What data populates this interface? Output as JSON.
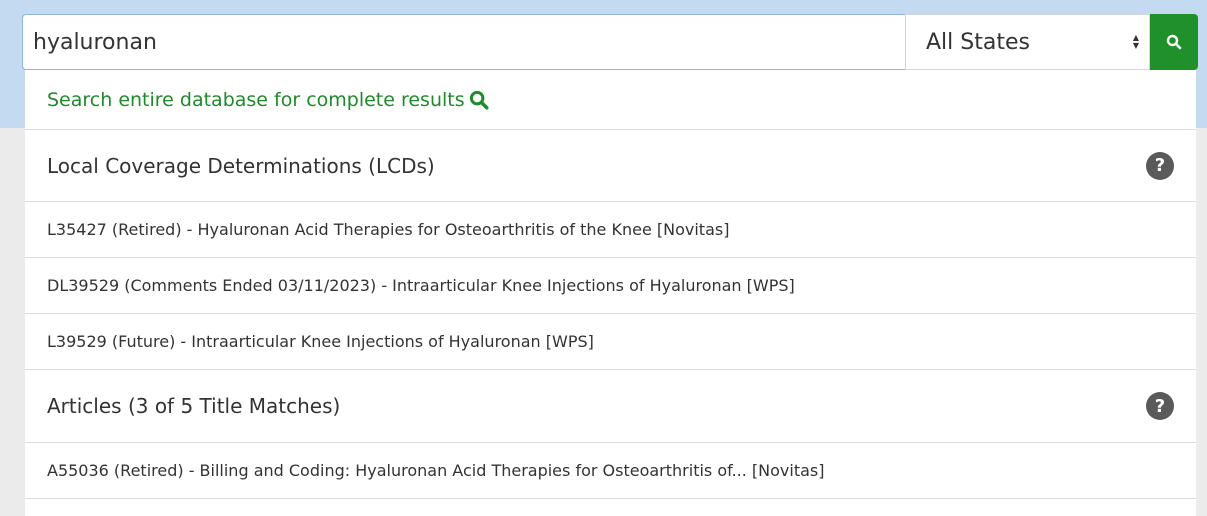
{
  "search": {
    "value": "hyaluronan",
    "state_selected": "All States",
    "button_icon": "search-icon",
    "accent_color": "#20902a"
  },
  "dropdown": {
    "search_all_label": "Search entire database for complete results",
    "sections": [
      {
        "title": "Local Coverage Determinations (LCDs)",
        "help_icon": "question-circle-icon",
        "items": [
          "L35427 (Retired) - Hyaluronan Acid Therapies for Osteoarthritis of the Knee [Novitas]",
          "DL39529 (Comments Ended 03/11/2023) - Intraarticular Knee Injections of Hyaluronan [WPS]",
          "L39529 (Future) - Intraarticular Knee Injections of Hyaluronan [WPS]"
        ]
      },
      {
        "title": "Articles (3 of 5 Title Matches)",
        "help_icon": "question-circle-icon",
        "items": [
          "A55036 (Retired) - Billing and Coding: Hyaluronan Acid Therapies for Osteoarthritis of... [Novitas]"
        ]
      }
    ]
  }
}
